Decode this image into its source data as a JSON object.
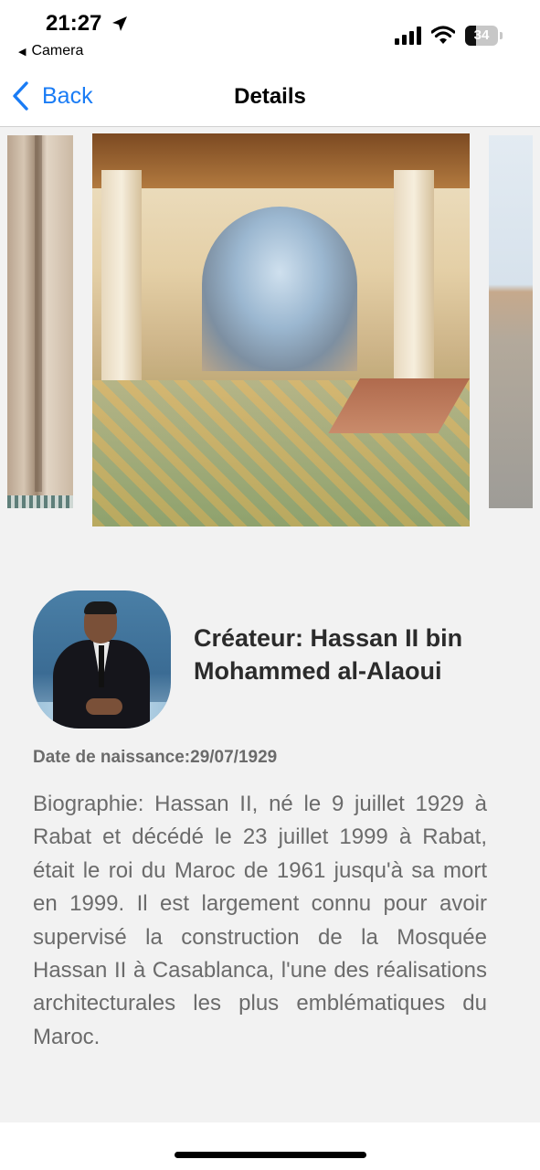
{
  "status_bar": {
    "time": "21:27",
    "back_app": "Camera",
    "battery_level": "34",
    "icons": [
      "location-arrow-icon",
      "signal-icon",
      "wifi-icon",
      "battery-icon"
    ]
  },
  "nav": {
    "back_label": "Back",
    "title": "Details",
    "accent_color": "#1a7cf5"
  },
  "carousel": {
    "images": [
      "mosque-arch-left",
      "mosque-interior-hall",
      "mosque-courtyard-right"
    ]
  },
  "creator": {
    "name": "Créateur: Hassan II bin Mohammed al-Alaoui",
    "birth_date": "Date de naissance:29/07/1929",
    "biography": "Biographie: Hassan II, né le 9 juillet 1929 à Rabat et décédé le 23 juillet 1999 à Rabat, était le roi du Maroc de 1961 jusqu'à sa mort en 1999. Il est largement connu pour avoir supervisé la construction de la Mosquée Hassan II à Casablanca, l'une des réalisations architecturales les plus emblématiques du Maroc."
  }
}
